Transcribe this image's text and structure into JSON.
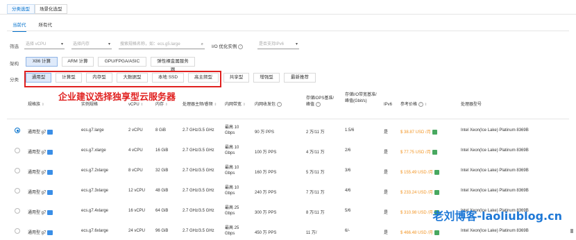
{
  "top_tabs": [
    {
      "label": "分类选型",
      "active": true
    },
    {
      "label": "场景化选型",
      "active": false
    }
  ],
  "gen_tabs": [
    {
      "label": "当前代",
      "active": true
    },
    {
      "label": "所有代",
      "active": false
    }
  ],
  "filter": {
    "label": "筛选",
    "vcpu_placeholder": "选择 vCPU",
    "memory_placeholder": "选择内存",
    "search_placeholder": "搜索规格名称，如：ecs.g5.large",
    "io_label": "I/O 优化实例",
    "ipv6_placeholder": "是否支持IPv6"
  },
  "arch": {
    "label": "架构",
    "buttons": [
      "X86 计算",
      "ARM 计算",
      "GPU/FPGA/ASIC",
      "弹性裸金属服务器"
    ]
  },
  "category": {
    "label": "分类",
    "buttons": [
      "通用型",
      "计算型",
      "内存型",
      "大数据型",
      "本地 SSD",
      "高主频型",
      "共享型",
      "增强型",
      "最新推荐"
    ]
  },
  "annotation": "企业建议选择独享型云服务器",
  "table": {
    "headers": {
      "family": "规格族",
      "spec": "实例规格",
      "vcpu": "vCPU",
      "mem": "内存",
      "cpu_freq": "处理器主频/睿频",
      "bandwidth": "内网带宽",
      "pps": "内网收发包",
      "iops": "存储IOPS基准/峰值",
      "storage_bw": "存储I/O带宽基准/峰值(Gbit/s)",
      "ipv6": "IPv6",
      "price": "参考价格",
      "cpu_model": "处理器型号"
    },
    "rows": [
      {
        "family": "通用型 g7",
        "spec": "ecs.g7.large",
        "vcpu": "2 vCPU",
        "mem": "8 GiB",
        "freq": "2.7 GHz/3.5 GHz",
        "bw1": "最高 10",
        "bw2": "Gbps",
        "pps": "90 万 PPS",
        "iops": "2 万/11 万",
        "sbw": "1.5/6",
        "ipv6": "是",
        "price": "$ 38.87 USD /月",
        "cpu": "Intel Xeon(Ice Lake) Platinum 8369B",
        "selected": true
      },
      {
        "family": "通用型 g7",
        "spec": "ecs.g7.xlarge",
        "vcpu": "4 vCPU",
        "mem": "16 GiB",
        "freq": "2.7 GHz/3.5 GHz",
        "bw1": "最高 10",
        "bw2": "Gbps",
        "pps": "100 万 PPS",
        "iops": "4 万/11 万",
        "sbw": "2/6",
        "ipv6": "是",
        "price": "$ 77.75 USD /月",
        "cpu": "Intel Xeon(Ice Lake) Platinum 8369B",
        "selected": false
      },
      {
        "family": "通用型 g7",
        "spec": "ecs.g7.2xlarge",
        "vcpu": "8 vCPU",
        "mem": "32 GiB",
        "freq": "2.7 GHz/3.5 GHz",
        "bw1": "最高 10",
        "bw2": "Gbps",
        "pps": "160 万 PPS",
        "iops": "5 万/11 万",
        "sbw": "3/6",
        "ipv6": "是",
        "price": "$ 155.49 USD /月",
        "cpu": "Intel Xeon(Ice Lake) Platinum 8369B",
        "selected": false
      },
      {
        "family": "通用型 g7",
        "spec": "ecs.g7.3xlarge",
        "vcpu": "12 vCPU",
        "mem": "48 GiB",
        "freq": "2.7 GHz/3.5 GHz",
        "bw1": "最高 10",
        "bw2": "Gbps",
        "pps": "240 万 PPS",
        "iops": "7 万/11 万",
        "sbw": "4/6",
        "ipv6": "是",
        "price": "$ 233.24 USD /月",
        "cpu": "Intel Xeon(Ice Lake) Platinum 8369B",
        "selected": false
      },
      {
        "family": "通用型 g7",
        "spec": "ecs.g7.4xlarge",
        "vcpu": "16 vCPU",
        "mem": "64 GiB",
        "freq": "2.7 GHz/3.5 GHz",
        "bw1": "最高 25",
        "bw2": "Gbps",
        "pps": "300 万 PPS",
        "iops": "8 万/11 万",
        "sbw": "5/6",
        "ipv6": "是",
        "price": "$ 310.98 USD /月",
        "cpu": "Intel Xeon(Ice Lake) Platinum 8369B",
        "selected": false
      },
      {
        "family": "通用型 g7",
        "spec": "ecs.g7.6xlarge",
        "vcpu": "24 vCPU",
        "mem": "96 GiB",
        "freq": "2.7 GHz/3.5 GHz",
        "bw1": "最高 25",
        "bw2": "Gbps",
        "pps": "450 万 PPS",
        "iops": "11 万/",
        "sbw": "6/-",
        "ipv6": "是",
        "price": "$ 466.48 USD /月",
        "cpu": "Intel Xeon(Ice Lake) Platinum 8369B",
        "selected": false
      }
    ]
  },
  "watermark": "老刘博客-laoliublog.cn"
}
